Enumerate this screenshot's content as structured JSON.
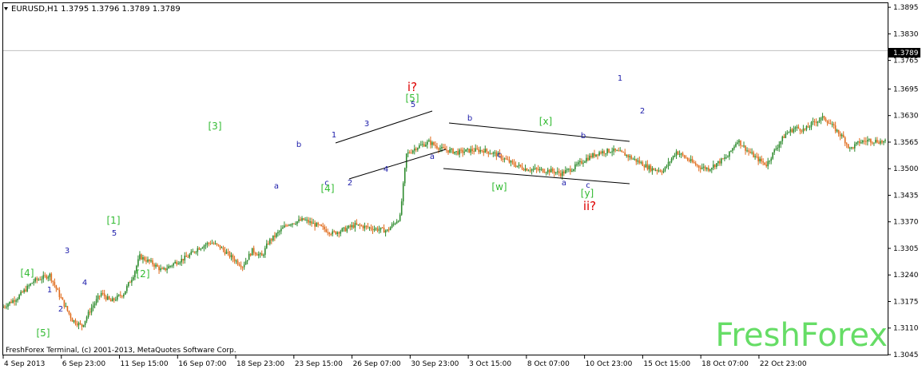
{
  "chart_header": "EURUSD,H1  1.3795 1.3796 1.3789 1.3789",
  "footer_text": "FreshForex Terminal, (c) 2001-2013, MetaQuotes Software Corp.",
  "watermark": "FreshForex",
  "current_price_label": "1.3789",
  "colors": {
    "background": "#ffffff",
    "axis": "#000000",
    "bull": "#2e8b2e",
    "bear": "#e06a1a",
    "wave_green": "#33bb33",
    "wave_blue": "#1c1caa",
    "wave_red": "#dd0000",
    "watermark": "#66dd66",
    "price_line": "#c0c0c0"
  },
  "chart_data": {
    "type": "candlestick",
    "symbol": "EURUSD",
    "timeframe": "H1",
    "ohlc_last": {
      "open": 1.3795,
      "high": 1.3796,
      "low": 1.3789,
      "close": 1.3789
    },
    "ylim": [
      1.3045,
      1.3905
    ],
    "y_ticks": [
      "1.3895",
      "1.3830",
      "1.3765",
      "1.3695",
      "1.3630",
      "1.3565",
      "1.3500",
      "1.3435",
      "1.3370",
      "1.3305",
      "1.3240",
      "1.3175",
      "1.3110",
      "1.3045"
    ],
    "x_ticks": [
      "4 Sep 2013",
      "6 Sep 23:00",
      "11 Sep 15:00",
      "16 Sep 07:00",
      "18 Sep 23:00",
      "23 Sep 15:00",
      "26 Sep 07:00",
      "30 Sep 23:00",
      "3 Oct 15:00",
      "8 Oct 07:00",
      "10 Oct 23:00",
      "15 Oct 15:00",
      "18 Oct 07:00",
      "22 Oct 23:00"
    ],
    "x_range": [
      0,
      55
    ],
    "price_path": [
      [
        0,
        1.316
      ],
      [
        1,
        1.3185
      ],
      [
        2,
        1.3225
      ],
      [
        3,
        1.324
      ],
      [
        3.6,
        1.319
      ],
      [
        4.4,
        1.313
      ],
      [
        5,
        1.3115
      ],
      [
        5.6,
        1.316
      ],
      [
        6.2,
        1.3195
      ],
      [
        6.8,
        1.3175
      ],
      [
        7.6,
        1.3195
      ],
      [
        8.2,
        1.324
      ],
      [
        8.6,
        1.3285
      ],
      [
        9.4,
        1.3268
      ],
      [
        10,
        1.325
      ],
      [
        10.8,
        1.327
      ],
      [
        11.6,
        1.3285
      ],
      [
        12.2,
        1.3305
      ],
      [
        13,
        1.332
      ],
      [
        13.6,
        1.3308
      ],
      [
        14.4,
        1.328
      ],
      [
        15,
        1.3262
      ],
      [
        15.6,
        1.33
      ],
      [
        16.2,
        1.3285
      ],
      [
        16.6,
        1.332
      ],
      [
        17,
        1.3335
      ],
      [
        17.8,
        1.3365
      ],
      [
        18.8,
        1.3375
      ],
      [
        19.8,
        1.3358
      ],
      [
        20.6,
        1.3342
      ],
      [
        21.4,
        1.3352
      ],
      [
        22,
        1.3362
      ],
      [
        23,
        1.3355
      ],
      [
        24,
        1.3348
      ],
      [
        24.8,
        1.3382
      ],
      [
        25.2,
        1.3535
      ],
      [
        25.8,
        1.3552
      ],
      [
        26.6,
        1.3565
      ],
      [
        27.4,
        1.3548
      ],
      [
        28.4,
        1.354
      ],
      [
        29.2,
        1.3545
      ],
      [
        30,
        1.3545
      ],
      [
        30.8,
        1.3535
      ],
      [
        31.8,
        1.3512
      ],
      [
        32.6,
        1.35
      ],
      [
        33.4,
        1.3497
      ],
      [
        34.2,
        1.3495
      ],
      [
        34.8,
        1.3488
      ],
      [
        35.6,
        1.3502
      ],
      [
        36.4,
        1.3525
      ],
      [
        37.2,
        1.354
      ],
      [
        38,
        1.3545
      ],
      [
        38.8,
        1.3535
      ],
      [
        39.6,
        1.3518
      ],
      [
        40.4,
        1.35
      ],
      [
        41.2,
        1.3495
      ],
      [
        42,
        1.3542
      ],
      [
        42.8,
        1.352
      ],
      [
        43.4,
        1.3505
      ],
      [
        44,
        1.35
      ],
      [
        44.6,
        1.3515
      ],
      [
        45.2,
        1.353
      ],
      [
        45.8,
        1.357
      ],
      [
        46.4,
        1.3545
      ],
      [
        47,
        1.3525
      ],
      [
        47.6,
        1.351
      ],
      [
        48.2,
        1.355
      ],
      [
        48.8,
        1.3585
      ],
      [
        49.4,
        1.36
      ],
      [
        50,
        1.3595
      ],
      [
        50.6,
        1.3615
      ],
      [
        51.2,
        1.3625
      ],
      [
        51.8,
        1.36
      ],
      [
        52.4,
        1.3575
      ],
      [
        52.8,
        1.3548
      ],
      [
        53.4,
        1.3565
      ],
      [
        54,
        1.357
      ],
      [
        55,
        1.3565
      ]
    ]
  },
  "wave_labels": [
    {
      "text": "[4]",
      "color": "green",
      "x": 34,
      "y": 346
    },
    {
      "text": "1",
      "color": "blue",
      "x": 62,
      "y": 366
    },
    {
      "text": "2",
      "color": "blue",
      "x": 76,
      "y": 390
    },
    {
      "text": "[5]",
      "color": "green",
      "x": 54,
      "y": 421
    },
    {
      "text": "3",
      "color": "blue",
      "x": 84,
      "y": 317
    },
    {
      "text": "4",
      "color": "blue",
      "x": 106,
      "y": 357
    },
    {
      "text": "[1]",
      "color": "green",
      "x": 142,
      "y": 280
    },
    {
      "text": "5",
      "color": "blue",
      "x": 143,
      "y": 295
    },
    {
      "text": "[2]",
      "color": "green",
      "x": 179,
      "y": 347
    },
    {
      "text": "[3]",
      "color": "green",
      "x": 269,
      "y": 162
    },
    {
      "text": "b",
      "color": "blue",
      "x": 374,
      "y": 184
    },
    {
      "text": "a",
      "color": "blue",
      "x": 346,
      "y": 236
    },
    {
      "text": "c",
      "color": "blue",
      "x": 409,
      "y": 232
    },
    {
      "text": "[4]",
      "color": "green",
      "x": 410,
      "y": 240
    },
    {
      "text": "1",
      "color": "blue",
      "x": 418,
      "y": 172
    },
    {
      "text": "2",
      "color": "blue",
      "x": 438,
      "y": 232
    },
    {
      "text": "3",
      "color": "blue",
      "x": 459,
      "y": 158
    },
    {
      "text": "4",
      "color": "blue",
      "x": 483,
      "y": 215
    },
    {
      "text": "5",
      "color": "blue",
      "x": 517,
      "y": 134
    },
    {
      "text": "[5]",
      "color": "green",
      "x": 516,
      "y": 127
    },
    {
      "text": "i?",
      "color": "red",
      "x": 516,
      "y": 114
    },
    {
      "text": "a",
      "color": "blue",
      "x": 541,
      "y": 199
    },
    {
      "text": "b",
      "color": "blue",
      "x": 588,
      "y": 151
    },
    {
      "text": "c",
      "color": "blue",
      "x": 625,
      "y": 197
    },
    {
      "text": "[w]",
      "color": "green",
      "x": 625,
      "y": 238
    },
    {
      "text": "[x]",
      "color": "green",
      "x": 683,
      "y": 156
    },
    {
      "text": "b",
      "color": "blue",
      "x": 730,
      "y": 173
    },
    {
      "text": "a",
      "color": "blue",
      "x": 706,
      "y": 232
    },
    {
      "text": "c",
      "color": "blue",
      "x": 736,
      "y": 235
    },
    {
      "text": "[y]",
      "color": "green",
      "x": 735,
      "y": 246
    },
    {
      "text": "ii?",
      "color": "red",
      "x": 738,
      "y": 263
    },
    {
      "text": "1",
      "color": "blue",
      "x": 776,
      "y": 101
    },
    {
      "text": "2",
      "color": "blue",
      "x": 804,
      "y": 142
    }
  ]
}
